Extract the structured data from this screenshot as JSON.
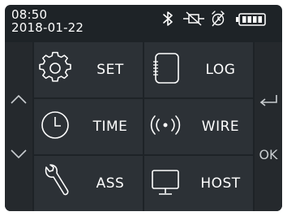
{
  "status": {
    "time": "08:50",
    "date": "2018-01-22",
    "icons": [
      "bluetooth-icon",
      "network-disconnected-icon",
      "alarm-off-icon",
      "battery-full-icon"
    ]
  },
  "side": {
    "up_icon": "chevron-up-icon",
    "down_icon": "chevron-down-icon",
    "back_icon": "return-arrow-icon",
    "ok_label": "OK"
  },
  "menu": [
    {
      "label": "SET",
      "icon": "gear-icon"
    },
    {
      "label": "LOG",
      "icon": "log-icon"
    },
    {
      "label": "TIME",
      "icon": "clock-icon"
    },
    {
      "label": "WIRE",
      "icon": "wireless-signal-icon"
    },
    {
      "label": "ASS",
      "icon": "wrench-icon"
    },
    {
      "label": "HOST",
      "icon": "monitor-icon"
    }
  ],
  "colors": {
    "background": "#1e2327",
    "tile": "#2c3136",
    "side_column": "#25292d",
    "foreground": "#ffffff"
  }
}
